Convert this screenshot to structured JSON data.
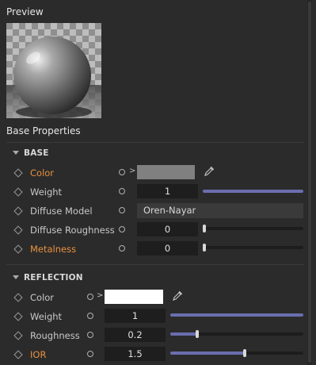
{
  "preview": {
    "title": "Preview"
  },
  "base_properties": {
    "title": "Base Properties"
  },
  "base": {
    "header": "BASE",
    "rows": {
      "color": {
        "label": "Color",
        "swatch": "#808080"
      },
      "weight": {
        "label": "Weight",
        "value": "1",
        "slider": 1.0
      },
      "diffuse_model": {
        "label": "Diffuse Model",
        "value": "Oren-Nayar"
      },
      "diffuse_roughness": {
        "label": "Diffuse Roughness",
        "value": "0",
        "slider": 0.0
      },
      "metalness": {
        "label": "Metalness",
        "value": "0",
        "slider": 0.0
      }
    }
  },
  "reflection": {
    "header": "REFLECTION",
    "rows": {
      "color": {
        "label": "Color",
        "swatch": "#ffffff"
      },
      "weight": {
        "label": "Weight",
        "value": "1",
        "slider": 1.0
      },
      "roughness": {
        "label": "Roughness",
        "value": "0.2",
        "slider": 0.2
      },
      "ior": {
        "label": "IOR",
        "value": "1.5",
        "slider": 0.56
      }
    }
  },
  "colors": {
    "accent_label": "#e8913f",
    "slider_fill": "#6a6eae"
  }
}
